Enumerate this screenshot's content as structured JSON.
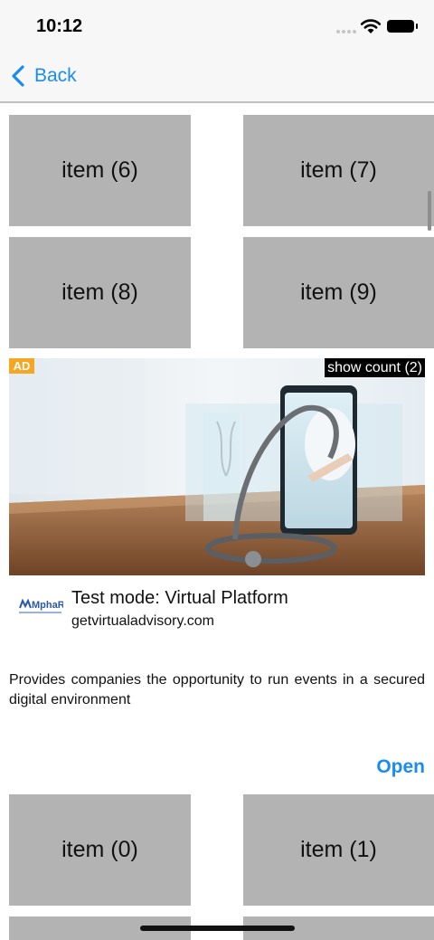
{
  "status_bar": {
    "time": "10:12"
  },
  "nav": {
    "back_label": "Back"
  },
  "grid_top": [
    {
      "left": "item (6)",
      "right": "item (7)"
    },
    {
      "left": "item (8)",
      "right": "item (9)"
    }
  ],
  "ad": {
    "badge": "AD",
    "show_count": "show count (2)",
    "title": "Test mode: Virtual Platform",
    "domain": "getvirtualadvisory.com",
    "body": "Provides companies the opportunity to run events in a secured digital environment",
    "cta": "Open",
    "logo_text": "MphaR"
  },
  "grid_bottom": [
    {
      "left": "item (0)",
      "right": "item (1)"
    }
  ],
  "colors": {
    "accent": "#1a8cf0",
    "tile": "#b3b3b3",
    "ad_badge": "#f5a623"
  }
}
